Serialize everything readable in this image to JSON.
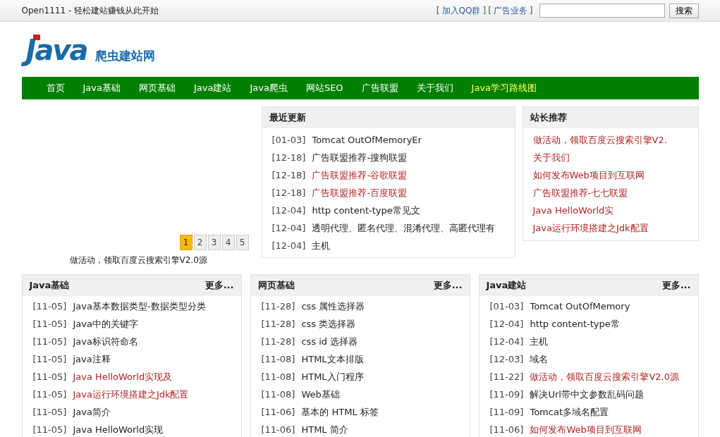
{
  "top_bar": {
    "site_slogan": "Open1111 - 轻松建站赚钱从此开始",
    "links": [
      {
        "open": "[",
        "label": "加入QQ群",
        "close": "]"
      },
      {
        "open": "[",
        "label": "广告业务",
        "close": "]"
      }
    ],
    "search": {
      "button": "搜索"
    }
  },
  "logo": {
    "word": "Java",
    "subtitle": "爬虫建站网"
  },
  "nav": [
    {
      "label": "首页",
      "highlight": false
    },
    {
      "label": "Java基础",
      "highlight": false
    },
    {
      "label": "网页基础",
      "highlight": false
    },
    {
      "label": "Java建站",
      "highlight": false
    },
    {
      "label": "Java爬虫",
      "highlight": false
    },
    {
      "label": "网站SEO",
      "highlight": false
    },
    {
      "label": "广告联盟",
      "highlight": false
    },
    {
      "label": "关于我们",
      "highlight": false
    },
    {
      "label": "Java学习路线图",
      "highlight": true
    }
  ],
  "slider": {
    "pages": [
      {
        "label": "1",
        "selected": true
      },
      {
        "label": "2",
        "selected": false
      },
      {
        "label": "3",
        "selected": false
      },
      {
        "label": "4",
        "selected": false
      },
      {
        "label": "5",
        "selected": false
      }
    ],
    "caption": "做活动，领取百度云搜索引擎V2.0源"
  },
  "latest": {
    "title": "最近更新",
    "items": [
      {
        "date": "[01-03]",
        "title": "Tomcat OutOfMemoryEr",
        "hot": false
      },
      {
        "date": "[12-18]",
        "title": "广告联盟推荐-搜狗联盟",
        "hot": false
      },
      {
        "date": "[12-18]",
        "title": "广告联盟推荐-谷歌联盟",
        "hot": true
      },
      {
        "date": "[12-18]",
        "title": "广告联盟推荐-百度联盟",
        "hot": true
      },
      {
        "date": "[12-04]",
        "title": "http content-type常见文",
        "hot": false
      },
      {
        "date": "[12-04]",
        "title": "透明代理、匿名代理、混淆代理、高匿代理有",
        "hot": false
      },
      {
        "date": "[12-04]",
        "title": "主机",
        "hot": false
      }
    ]
  },
  "recommend": {
    "title": "站长推荐",
    "items": [
      {
        "title": "做活动，领取百度云搜索引擎V2.",
        "hot": true
      },
      {
        "title": "关于我们",
        "hot": true
      },
      {
        "title": "如何发布Web项目到互联网",
        "hot": true
      },
      {
        "title": "广告联盟推荐-七七联盟",
        "hot": true
      },
      {
        "title": "Java HelloWorld实",
        "hot": true
      },
      {
        "title": "Java运行环境搭建之Jdk配置",
        "hot": true
      }
    ]
  },
  "sections": [
    {
      "title": "Java基础",
      "more": "更多...",
      "items": [
        {
          "date": "[11-05]",
          "title": "Java基本数据类型-数据类型分类",
          "hot": false
        },
        {
          "date": "[11-05]",
          "title": "Java中的关键字",
          "hot": false
        },
        {
          "date": "[11-05]",
          "title": "Java标识符命名",
          "hot": false
        },
        {
          "date": "[11-05]",
          "title": "java注释",
          "hot": false
        },
        {
          "date": "[11-05]",
          "title": "Java HelloWorld实现及",
          "hot": true
        },
        {
          "date": "[11-05]",
          "title": "Java运行环境搭建之Jdk配置",
          "hot": true
        },
        {
          "date": "[11-05]",
          "title": "Java简介",
          "hot": false
        },
        {
          "date": "[11-05]",
          "title": "Java HelloWorld实现",
          "hot": false
        }
      ]
    },
    {
      "title": "网页基础",
      "more": "更多...",
      "items": [
        {
          "date": "[11-28]",
          "title": "css 属性选择器",
          "hot": false
        },
        {
          "date": "[11-28]",
          "title": "css 类选择器",
          "hot": false
        },
        {
          "date": "[11-28]",
          "title": "css id 选择器",
          "hot": false
        },
        {
          "date": "[11-08]",
          "title": "HTML文本排版",
          "hot": false
        },
        {
          "date": "[11-08]",
          "title": "HTML入门程序",
          "hot": false
        },
        {
          "date": "[11-08]",
          "title": "Web基础",
          "hot": false
        },
        {
          "date": "[11-06]",
          "title": "基本的 HTML 标签",
          "hot": false
        },
        {
          "date": "[11-06]",
          "title": "HTML 简介",
          "hot": false
        }
      ]
    },
    {
      "title": "Java建站",
      "more": "更多...",
      "items": [
        {
          "date": "[01-03]",
          "title": "Tomcat OutOfMemory",
          "hot": false
        },
        {
          "date": "[12-04]",
          "title": "http content-type常",
          "hot": false
        },
        {
          "date": "[12-04]",
          "title": "主机",
          "hot": false
        },
        {
          "date": "[12-03]",
          "title": "域名",
          "hot": false
        },
        {
          "date": "[11-22]",
          "title": "做活动，领取百度云搜索引擎V2.0源",
          "hot": true
        },
        {
          "date": "[11-09]",
          "title": "解决Url带中文参数乱码问题",
          "hot": false
        },
        {
          "date": "[11-09]",
          "title": "Tomcat多域名配置",
          "hot": false
        },
        {
          "date": "[11-06]",
          "title": "如何发布Web项目到互联网",
          "hot": true
        }
      ]
    }
  ]
}
